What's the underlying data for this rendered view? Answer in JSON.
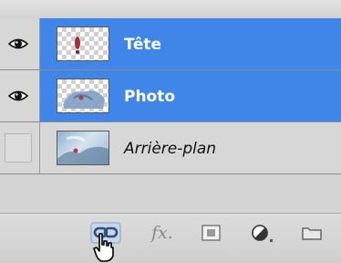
{
  "layers": [
    {
      "name": "Tête",
      "visible": true,
      "selected": true,
      "thumbnail": "transparent-figure-icon"
    },
    {
      "name": "Photo",
      "visible": true,
      "selected": true,
      "thumbnail": "transparent-photo-icon"
    },
    {
      "name": "Arrière-plan",
      "visible": false,
      "selected": false,
      "thumbnail": "background-photo-icon"
    }
  ],
  "footer": {
    "fx_label": "fx."
  },
  "colors": {
    "selection": "#3f86e8",
    "panel": "#d4d4d4"
  }
}
